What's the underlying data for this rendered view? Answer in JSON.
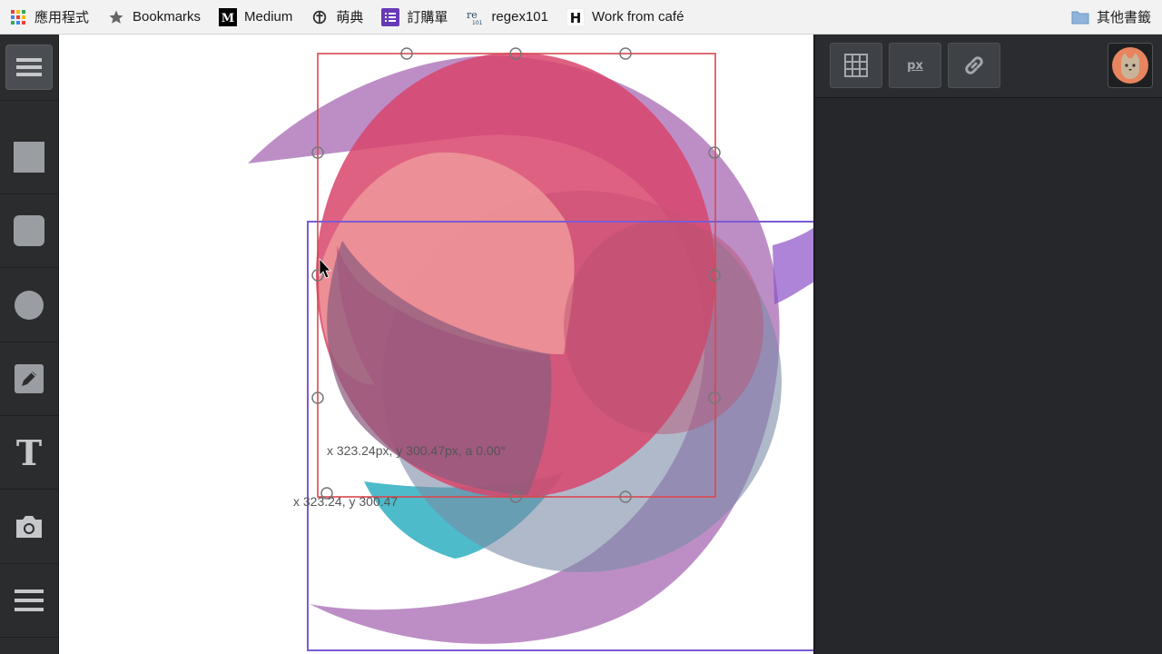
{
  "bookmarks": {
    "items": [
      {
        "label": "應用程式",
        "icon": "apps-grid-icon"
      },
      {
        "label": "Bookmarks",
        "icon": "star-icon"
      },
      {
        "label": "Medium",
        "icon": "medium-logo-icon"
      },
      {
        "label": "萌典",
        "icon": "moedict-icon"
      },
      {
        "label": "訂購單",
        "icon": "list-icon"
      },
      {
        "label": "regex101",
        "icon": "regex101-icon"
      },
      {
        "label": "Work from café",
        "icon": "h-logo-icon"
      }
    ],
    "other": {
      "label": "其他書籤",
      "icon": "folder-icon"
    }
  },
  "toolbar": {
    "tools": [
      "menu-icon",
      "square-icon",
      "rounded-square-icon",
      "circle-icon",
      "pencil-icon",
      "text-icon",
      "camera-icon",
      "list-icon"
    ],
    "text_tool_glyph": "T"
  },
  "canvas": {
    "transform_readout": "x 323.24px, y 300.47px, a 0.00°",
    "cursor_readout": "x 323.24, y 300.47"
  },
  "panel": {
    "buttons": [
      "grid-icon",
      "px-units-icon",
      "link-icon"
    ],
    "px_label": "px",
    "avatar": "cat-avatar-icon"
  },
  "colors": {
    "toolbar_bg": "#2a2c2e",
    "panel_bg": "#25272a",
    "selection_red": "#e0454a",
    "selection_purple": "#7b5bd6",
    "shape_pink": "#d54a6e",
    "shape_salmon": "#ec8a8a",
    "shape_purple": "#9a6fc0",
    "shape_teal": "#36b3c2"
  }
}
